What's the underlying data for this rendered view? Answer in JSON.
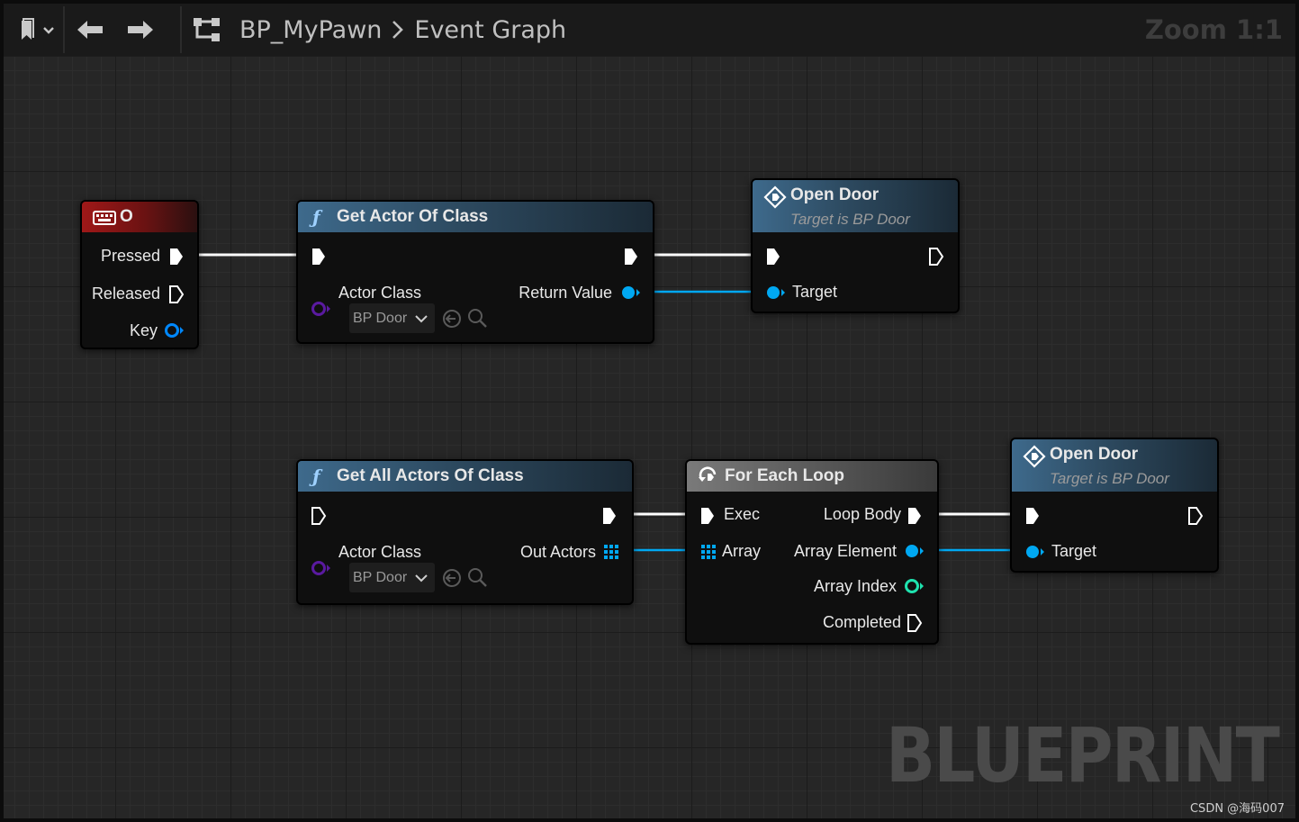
{
  "toolbar": {
    "breadcrumb_blueprint": "BP_MyPawn",
    "breadcrumb_graph": "Event Graph",
    "zoom": "Zoom 1:1"
  },
  "nodes": {
    "key_event": {
      "title": "O",
      "pins": {
        "pressed": "Pressed",
        "released": "Released",
        "key": "Key"
      }
    },
    "get_actor_of_class": {
      "title": "Get Actor Of Class",
      "pins": {
        "actor_class": "Actor Class",
        "return_value": "Return Value"
      },
      "actor_class_value": "BP Door"
    },
    "open_door_1": {
      "title": "Open Door",
      "subtitle": "Target is BP Door",
      "pins": {
        "target": "Target"
      }
    },
    "get_all_actors_of_class": {
      "title": "Get All Actors Of Class",
      "pins": {
        "actor_class": "Actor Class",
        "out_actors": "Out Actors"
      },
      "actor_class_value": "BP Door"
    },
    "for_each_loop": {
      "title": "For Each Loop",
      "pins": {
        "exec": "Exec",
        "array": "Array",
        "loop_body": "Loop Body",
        "array_element": "Array Element",
        "array_index": "Array Index",
        "completed": "Completed"
      }
    },
    "open_door_2": {
      "title": "Open Door",
      "subtitle": "Target is BP Door",
      "pins": {
        "target": "Target"
      }
    }
  },
  "watermark": "BLUEPRINT",
  "credit": "CSDN @海码007",
  "colors": {
    "object_pin": "#00a8f2",
    "class_pin": "#5a1aa0",
    "int_pin": "#1fe3af",
    "key_pin": "#0088ff",
    "exec_pin": "#ffffff",
    "func_header": "#3e6a8c",
    "event_header": "#a01818"
  },
  "icons": {
    "bookmark": "bookmark-icon",
    "back": "arrow-left-icon",
    "forward": "arrow-right-icon",
    "graph": "graph-icon",
    "function": "function-icon",
    "keyboard": "keyboard-icon",
    "event": "event-icon",
    "loop": "loop-icon"
  }
}
